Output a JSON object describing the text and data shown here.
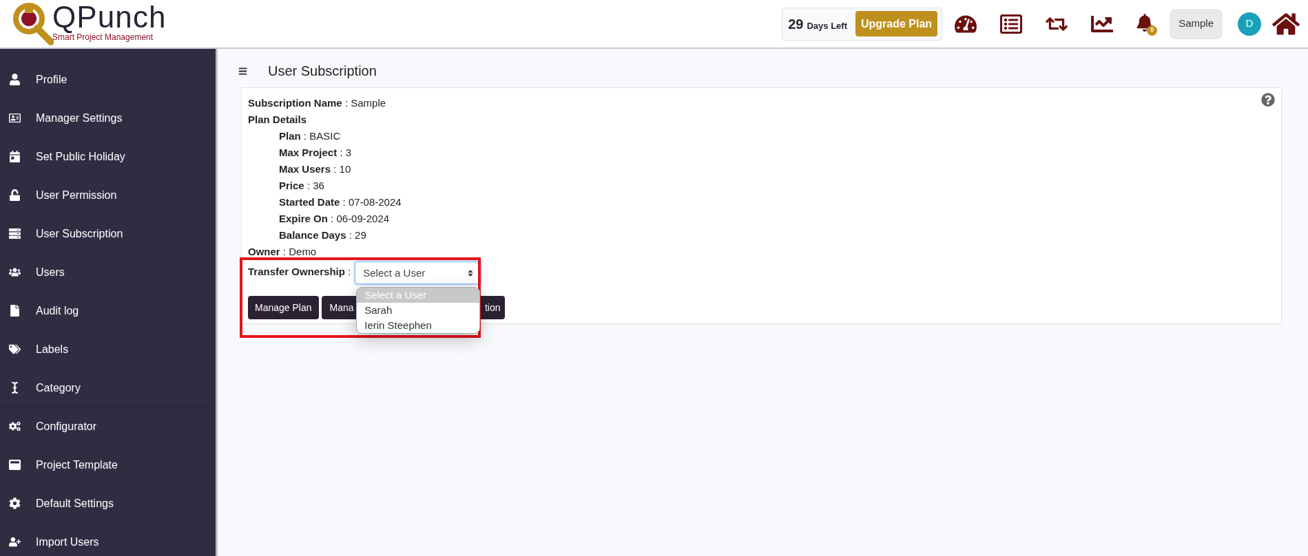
{
  "header": {
    "logo": {
      "name": "QPunch",
      "tagline": "Smart Project Management"
    },
    "trial": {
      "days": "29",
      "days_label": "Days Left",
      "upgrade": "Upgrade Plan"
    },
    "notification_count": "0",
    "user_button": "Sample",
    "avatar_initial": "D"
  },
  "sidebar": {
    "items": [
      {
        "label": "Profile",
        "selected": false
      },
      {
        "label": "Manager Settings",
        "selected": false
      },
      {
        "label": "Set Public Holiday",
        "selected": false
      },
      {
        "label": "User Permission",
        "selected": false
      },
      {
        "label": "User Subscription",
        "selected": false
      },
      {
        "label": "Users",
        "selected": false
      },
      {
        "label": "Audit log",
        "selected": false
      },
      {
        "label": "Labels",
        "selected": false
      },
      {
        "label": "Category",
        "selected": false
      },
      {
        "label": "Configurator",
        "selected": false
      },
      {
        "label": "Project Template",
        "selected": false
      },
      {
        "label": "Default Settings",
        "selected": false
      },
      {
        "label": "Import Users",
        "selected": false
      }
    ]
  },
  "page": {
    "title": "User Subscription",
    "separator": ":",
    "subscription_name": {
      "label": "Subscription Name",
      "value": "Sample"
    },
    "plan_details_heading": "Plan Details",
    "plan_details": [
      {
        "label": "Plan",
        "value": "BASIC"
      },
      {
        "label": "Max Project",
        "value": "3"
      },
      {
        "label": "Max Users",
        "value": "10"
      },
      {
        "label": "Price",
        "value": "36"
      },
      {
        "label": "Started Date",
        "value": "07-08-2024"
      },
      {
        "label": "Expire On",
        "value": "06-09-2024"
      },
      {
        "label": "Balance Days",
        "value": "29"
      }
    ],
    "owner": {
      "label": "Owner",
      "value": "Demo"
    },
    "transfer": {
      "label": "Transfer Ownership",
      "select_value": "Select a User",
      "expanded": true,
      "options": [
        {
          "label": "Select a User",
          "selected": true
        },
        {
          "label": "Sarah",
          "selected": false
        },
        {
          "label": "Ierin Steephen",
          "selected": false
        }
      ]
    },
    "buttons": [
      "Manage Plan",
      "Mana",
      "tion"
    ],
    "highlight_frame": true
  }
}
